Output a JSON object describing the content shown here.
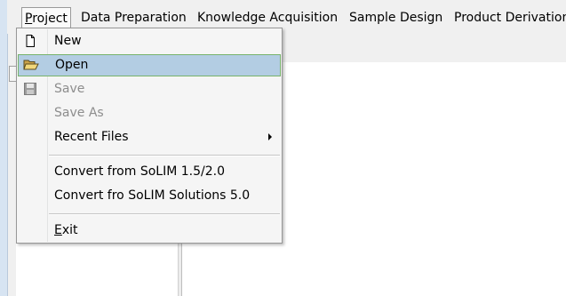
{
  "menubar": {
    "items": [
      {
        "label": "Project"
      },
      {
        "label": "Data Preparation"
      },
      {
        "label": "Knowledge Acquisition"
      },
      {
        "label": "Sample Design"
      },
      {
        "label": "Product Derivation"
      }
    ]
  },
  "project_menu": {
    "items": [
      {
        "label": "New",
        "icon": "new-file-icon",
        "enabled": true
      },
      {
        "label": "Open",
        "icon": "open-folder-icon",
        "enabled": true,
        "highlighted": true
      },
      {
        "label": "Save",
        "icon": "save-disk-icon",
        "enabled": false
      },
      {
        "label": "Save As",
        "enabled": false
      },
      {
        "label": "Recent Files",
        "enabled": true,
        "submenu": true
      },
      {
        "label": "Convert from SoLIM 1.5/2.0",
        "enabled": true
      },
      {
        "label": "Convert fro SoLIM Solutions 5.0",
        "enabled": true
      },
      {
        "label": "Exit",
        "enabled": true
      }
    ]
  },
  "colors": {
    "highlight_bg": "#b3cde3",
    "highlight_border": "#78b36c",
    "disabled_text": "#8d8d8d"
  }
}
